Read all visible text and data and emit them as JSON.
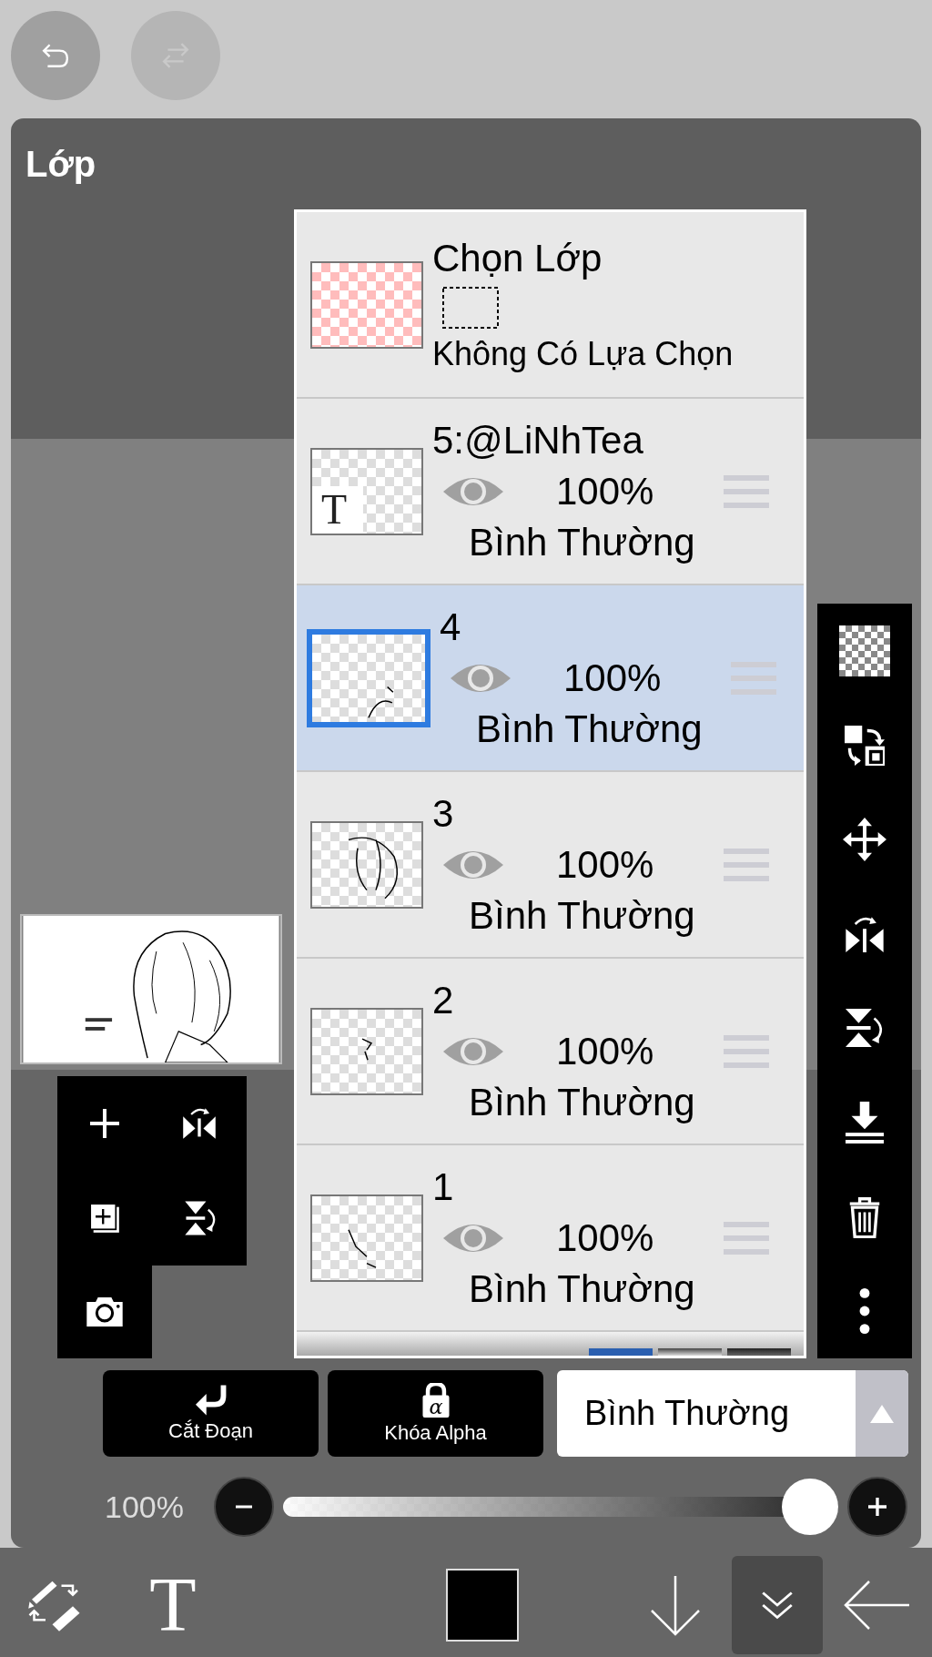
{
  "undo": {
    "disabled": false
  },
  "redo": {
    "disabled": true
  },
  "title": "Lớp",
  "selection_row": {
    "title": "Chọn Lớp",
    "status": "Không Có Lựa Chọn"
  },
  "layers": [
    {
      "name": "5:@LiNhTea",
      "kind": "text",
      "thumbnail_text": "T",
      "visible": true,
      "opacity": "100%",
      "blend": "Bình Thường",
      "selected": false
    },
    {
      "name": "4",
      "kind": "raster",
      "visible": true,
      "opacity": "100%",
      "blend": "Bình Thường",
      "selected": true
    },
    {
      "name": "3",
      "kind": "raster",
      "visible": true,
      "opacity": "100%",
      "blend": "Bình Thường",
      "selected": false
    },
    {
      "name": "2",
      "kind": "raster",
      "visible": true,
      "opacity": "100%",
      "blend": "Bình Thường",
      "selected": false
    },
    {
      "name": "1",
      "kind": "raster",
      "visible": true,
      "opacity": "100%",
      "blend": "Bình Thường",
      "selected": false
    }
  ],
  "actions": [
    {
      "kind": "clip",
      "label": "Cắt Đoạn"
    },
    {
      "kind": "alpha-lock",
      "label": "Khóa Alpha",
      "icon_text": "α"
    }
  ],
  "blend_mode": "Bình Thường",
  "opacity": {
    "reading": "100%",
    "level": 1.0
  },
  "toolbar": [
    {
      "kind": "brush-swap",
      "selected": false
    },
    {
      "kind": "text",
      "label": "T",
      "selected": false
    },
    {
      "kind": "color",
      "selected": false
    },
    {
      "kind": "down",
      "selected": false
    },
    {
      "kind": "layers",
      "selected": true
    },
    {
      "kind": "back",
      "selected": false
    }
  ]
}
